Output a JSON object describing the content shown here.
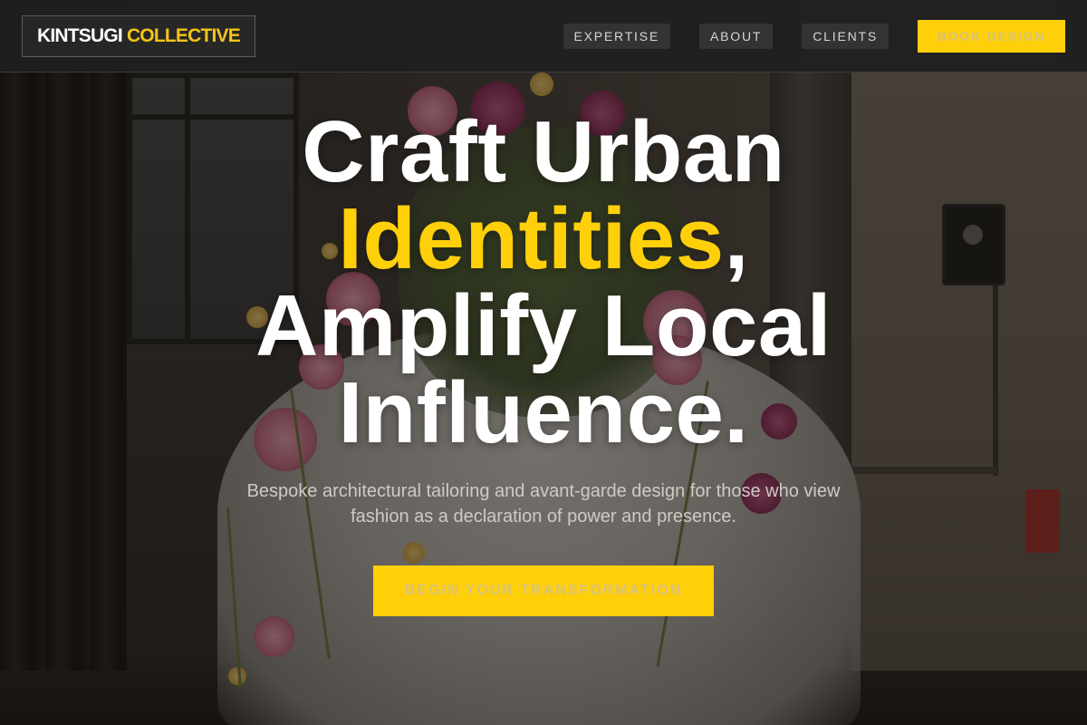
{
  "brand": {
    "name_part1": "KINTSUGI",
    "name_part2": "COLLECTIVE"
  },
  "nav": {
    "items": [
      {
        "label": "EXPERTISE"
      },
      {
        "label": "ABOUT"
      },
      {
        "label": "CLIENTS"
      }
    ],
    "cta_label": "BOOK DESIGN"
  },
  "hero": {
    "headline_line1": "Craft Urban",
    "headline_accent": "Identities",
    "headline_comma": ",",
    "headline_line3": "Amplify Local",
    "headline_line4": "Influence.",
    "subtitle": "Bespoke architectural tailoring and avant-garde design for those who view fashion as a declaration of power and presence.",
    "cta_label": "BEGIN YOUR TRANSFORMATION"
  },
  "colors": {
    "accent": "#ffd00a",
    "header_bg": "#202020",
    "text_primary": "#ffffff",
    "text_muted": "#cfcac4"
  }
}
